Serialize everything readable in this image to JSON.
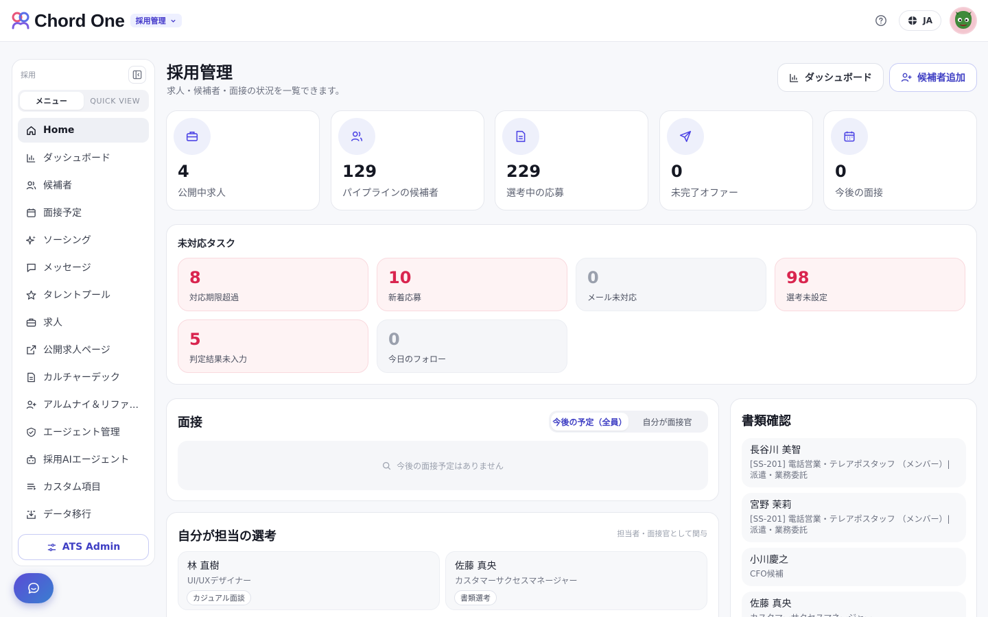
{
  "app": {
    "brand": "Chord One",
    "module_badge": "採用管理",
    "language": "JA"
  },
  "sidebar": {
    "section_label": "採用",
    "tabs": [
      "メニュー",
      "QUICK VIEW"
    ],
    "items": [
      {
        "label": "Home",
        "icon": "home-icon",
        "active": true
      },
      {
        "label": "ダッシュボード",
        "icon": "bar-chart-icon"
      },
      {
        "label": "候補者",
        "icon": "users-icon"
      },
      {
        "label": "面接予定",
        "icon": "calendar-icon"
      },
      {
        "label": "ソーシング",
        "icon": "sparkles-icon"
      },
      {
        "label": "メッセージ",
        "icon": "message-icon"
      },
      {
        "label": "タレントプール",
        "icon": "star-icon"
      },
      {
        "label": "求人",
        "icon": "briefcase-icon"
      },
      {
        "label": "公開求人ページ",
        "icon": "external-link-icon"
      },
      {
        "label": "カルチャーデック",
        "icon": "document-icon"
      },
      {
        "label": "アルムナイ＆リファ...",
        "icon": "user-plus-icon"
      },
      {
        "label": "エージェント管理",
        "icon": "handshake-icon"
      },
      {
        "label": "採用AIエージェント",
        "icon": "bot-icon"
      },
      {
        "label": "カスタム項目",
        "icon": "list-icon"
      },
      {
        "label": "データ移行",
        "icon": "download-icon"
      }
    ],
    "admin_button": "ATS Admin"
  },
  "header": {
    "title": "採用管理",
    "subtitle": "求人・候補者・面接の状況を一覧できます。",
    "dashboard_button": "ダッシュボード",
    "add_candidate_button": "候補者追加"
  },
  "stats": [
    {
      "value": "4",
      "label": "公開中求人",
      "icon": "briefcase-icon"
    },
    {
      "value": "129",
      "label": "パイプラインの候補者",
      "icon": "users-icon"
    },
    {
      "value": "229",
      "label": "選考中の応募",
      "icon": "document-icon"
    },
    {
      "value": "0",
      "label": "未完了オファー",
      "icon": "send-icon"
    },
    {
      "value": "0",
      "label": "今後の面接",
      "icon": "calendar-icon"
    }
  ],
  "tasks": {
    "title": "未対応タスク",
    "items": [
      {
        "value": "8",
        "label": "対応期限超過",
        "tone": "red"
      },
      {
        "value": "10",
        "label": "新着応募",
        "tone": "red"
      },
      {
        "value": "0",
        "label": "メール未対応",
        "tone": "gray"
      },
      {
        "value": "98",
        "label": "選考未設定",
        "tone": "red"
      },
      {
        "value": "5",
        "label": "判定結果未入力",
        "tone": "red"
      },
      {
        "value": "0",
        "label": "今日のフォロー",
        "tone": "gray"
      }
    ]
  },
  "interviews": {
    "title": "面接",
    "toggle": [
      "今後の予定（全員）",
      "自分が面接官"
    ],
    "empty_text": "今後の面接予定はありません"
  },
  "my_selection": {
    "title": "自分が担当の選考",
    "note": "担当者・面接官として関与",
    "candidates": [
      {
        "name": "林 直樹",
        "role": "UI/UXデザイナー",
        "stage": "カジュアル面談"
      },
      {
        "name": "佐藤 真央",
        "role": "カスタマーサクセスマネージャー",
        "stage": "書類選考"
      }
    ]
  },
  "documents": {
    "title": "書類確認",
    "items": [
      {
        "name": "長谷川 美智",
        "role": "[SS-201] 電話営業・テレアポスタッフ （メンバー）| 派遣・業務委託"
      },
      {
        "name": "宮野 茉莉",
        "role": "[SS-201] 電話営業・テレアポスタッフ （メンバー）| 派遣・業務委託"
      },
      {
        "name": "小川慶之",
        "role": "CFO候補"
      },
      {
        "name": "佐藤 真央",
        "role": "カスタマーサクセスマネージャー"
      }
    ]
  },
  "colors": {
    "accent": "#3f3fc4",
    "danger": "#d9254f",
    "muted": "#9aa0ad"
  }
}
